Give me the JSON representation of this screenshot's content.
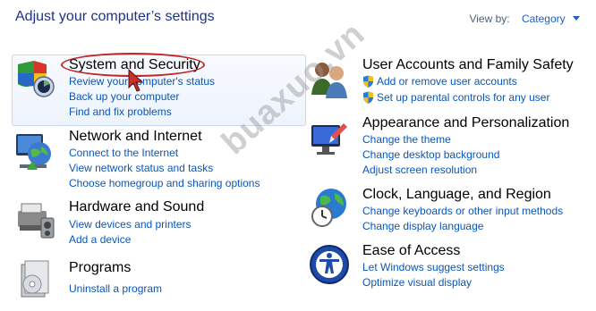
{
  "header": {
    "title": "Adjust your computer’s settings",
    "view_by_label": "View by:",
    "view_by_value": "Category"
  },
  "categories": [
    {
      "title": "System and Security",
      "links": [
        "Review your computer's status",
        "Back up your computer",
        "Find and fix problems"
      ]
    },
    {
      "title": "Network and Internet",
      "links": [
        "Connect to the Internet",
        "View network status and tasks",
        "Choose homegroup and sharing options"
      ]
    },
    {
      "title": "Hardware and Sound",
      "links": [
        "View devices and printers",
        "Add a device"
      ]
    },
    {
      "title": "Programs",
      "links": [
        "Uninstall a program"
      ]
    },
    {
      "title": "User Accounts and Family Safety",
      "links": [
        "Add or remove user accounts",
        "Set up parental controls for any user"
      ]
    },
    {
      "title": "Appearance and Personalization",
      "links": [
        "Change the theme",
        "Change desktop background",
        "Adjust screen resolution"
      ]
    },
    {
      "title": "Clock, Language, and Region",
      "links": [
        "Change keyboards or other input methods",
        "Change display language"
      ]
    },
    {
      "title": "Ease of Access",
      "links": [
        "Let Windows suggest settings",
        "Optimize visual display"
      ]
    }
  ],
  "watermark": "buaxuo.vn",
  "colors": {
    "title_green": "#1e6b1e",
    "link_blue": "#0b56b8",
    "header_blue": "#1e3287",
    "highlight_red": "#c0262a"
  }
}
